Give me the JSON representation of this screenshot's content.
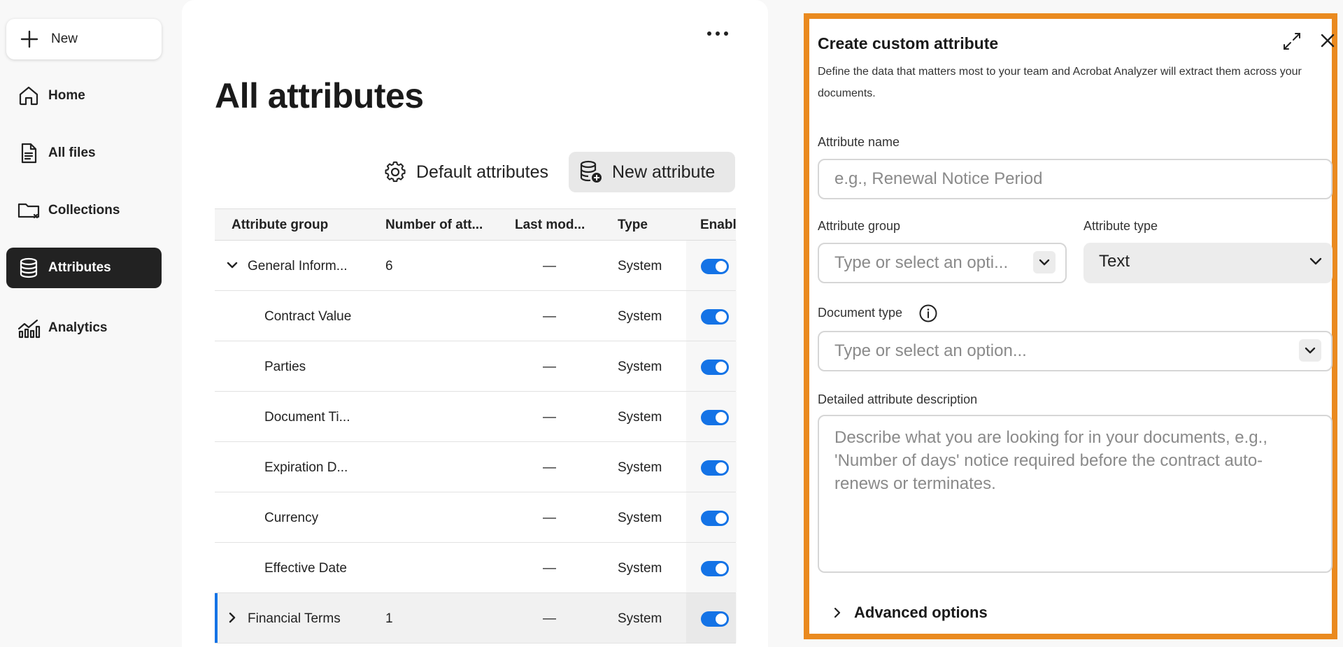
{
  "sidebar": {
    "new_label": "New",
    "items": [
      {
        "label": "Home",
        "icon": "home-icon"
      },
      {
        "label": "All files",
        "icon": "file-icon"
      },
      {
        "label": "Collections",
        "icon": "folder-icon"
      },
      {
        "label": "Attributes",
        "icon": "database-icon",
        "active": true
      },
      {
        "label": "Analytics",
        "icon": "analytics-icon"
      }
    ]
  },
  "main": {
    "title": "All attributes",
    "more_icon": "more-horizontal-icon",
    "default_attributes_label": "Default attributes",
    "new_attribute_label": "New attribute",
    "table": {
      "headers": [
        "Attribute group",
        "Number of att...",
        "Last mod...",
        "Type",
        "Enabl"
      ],
      "rows": [
        {
          "name": "General Inform...",
          "count": "6",
          "last_modified": "—",
          "type": "System",
          "enabled": true,
          "kind": "group-expanded"
        },
        {
          "name": "Contract Value",
          "count": "",
          "last_modified": "—",
          "type": "System",
          "enabled": true,
          "kind": "child"
        },
        {
          "name": "Parties",
          "count": "",
          "last_modified": "—",
          "type": "System",
          "enabled": true,
          "kind": "child"
        },
        {
          "name": "Document Ti...",
          "count": "",
          "last_modified": "—",
          "type": "System",
          "enabled": true,
          "kind": "child"
        },
        {
          "name": "Expiration D...",
          "count": "",
          "last_modified": "—",
          "type": "System",
          "enabled": true,
          "kind": "child"
        },
        {
          "name": "Currency",
          "count": "",
          "last_modified": "—",
          "type": "System",
          "enabled": true,
          "kind": "child"
        },
        {
          "name": "Effective Date",
          "count": "",
          "last_modified": "—",
          "type": "System",
          "enabled": true,
          "kind": "child"
        },
        {
          "name": "Financial Terms",
          "count": "1",
          "last_modified": "—",
          "type": "System",
          "enabled": true,
          "kind": "group-collapsed"
        }
      ]
    }
  },
  "panel": {
    "title": "Create custom attribute",
    "description": "Define the data that matters most to your team and Acrobat Analyzer will extract them across your documents.",
    "attribute_name_label": "Attribute name",
    "attribute_name_placeholder": "e.g., Renewal Notice Period",
    "attribute_group_label": "Attribute group",
    "attribute_group_placeholder": "Type or select an opti...",
    "attribute_type_label": "Attribute type",
    "attribute_type_value": "Text",
    "document_type_label": "Document type",
    "document_type_placeholder": "Type or select an option...",
    "description_label": "Detailed attribute description",
    "description_placeholder": "Describe what you are looking for in your documents, e.g., 'Number of days' notice required before the contract auto-renews or terminates.",
    "advanced_label": "Advanced options",
    "highlight_color": "#ea8a1f"
  },
  "colors": {
    "accent": "#1473e6",
    "active_nav": "#222222"
  }
}
